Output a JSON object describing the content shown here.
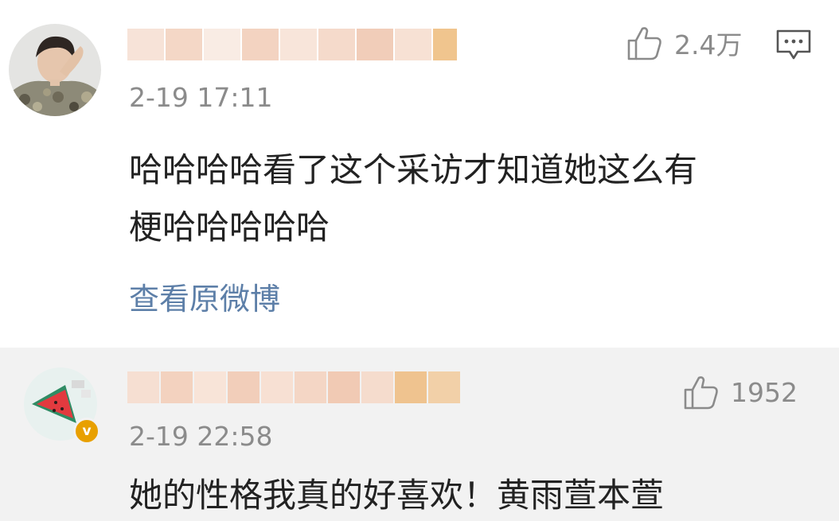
{
  "comments": [
    {
      "timestamp": "2-19 17:11",
      "likes": "2.4万",
      "content_lines": [
        "哈哈哈哈看了这个采访才知道她这么有",
        "梗哈哈哈哈哈"
      ],
      "view_original_label": "查看原微博",
      "icons": {
        "like": "thumbs-up-icon",
        "reply": "comment-bubble-icon"
      }
    },
    {
      "timestamp": "2-19 22:58",
      "likes": "1952",
      "content_lines": [
        "她的性格我真的好喜欢！黄雨萱本萱"
      ],
      "verified_badge": "v",
      "icons": {
        "like": "thumbs-up-icon"
      }
    }
  ],
  "colors": {
    "timestamp": "#8b8b8b",
    "link": "#5d7fa8",
    "text": "#222222",
    "alt_background": "#f2f2f2",
    "verified": "#e8a000"
  }
}
